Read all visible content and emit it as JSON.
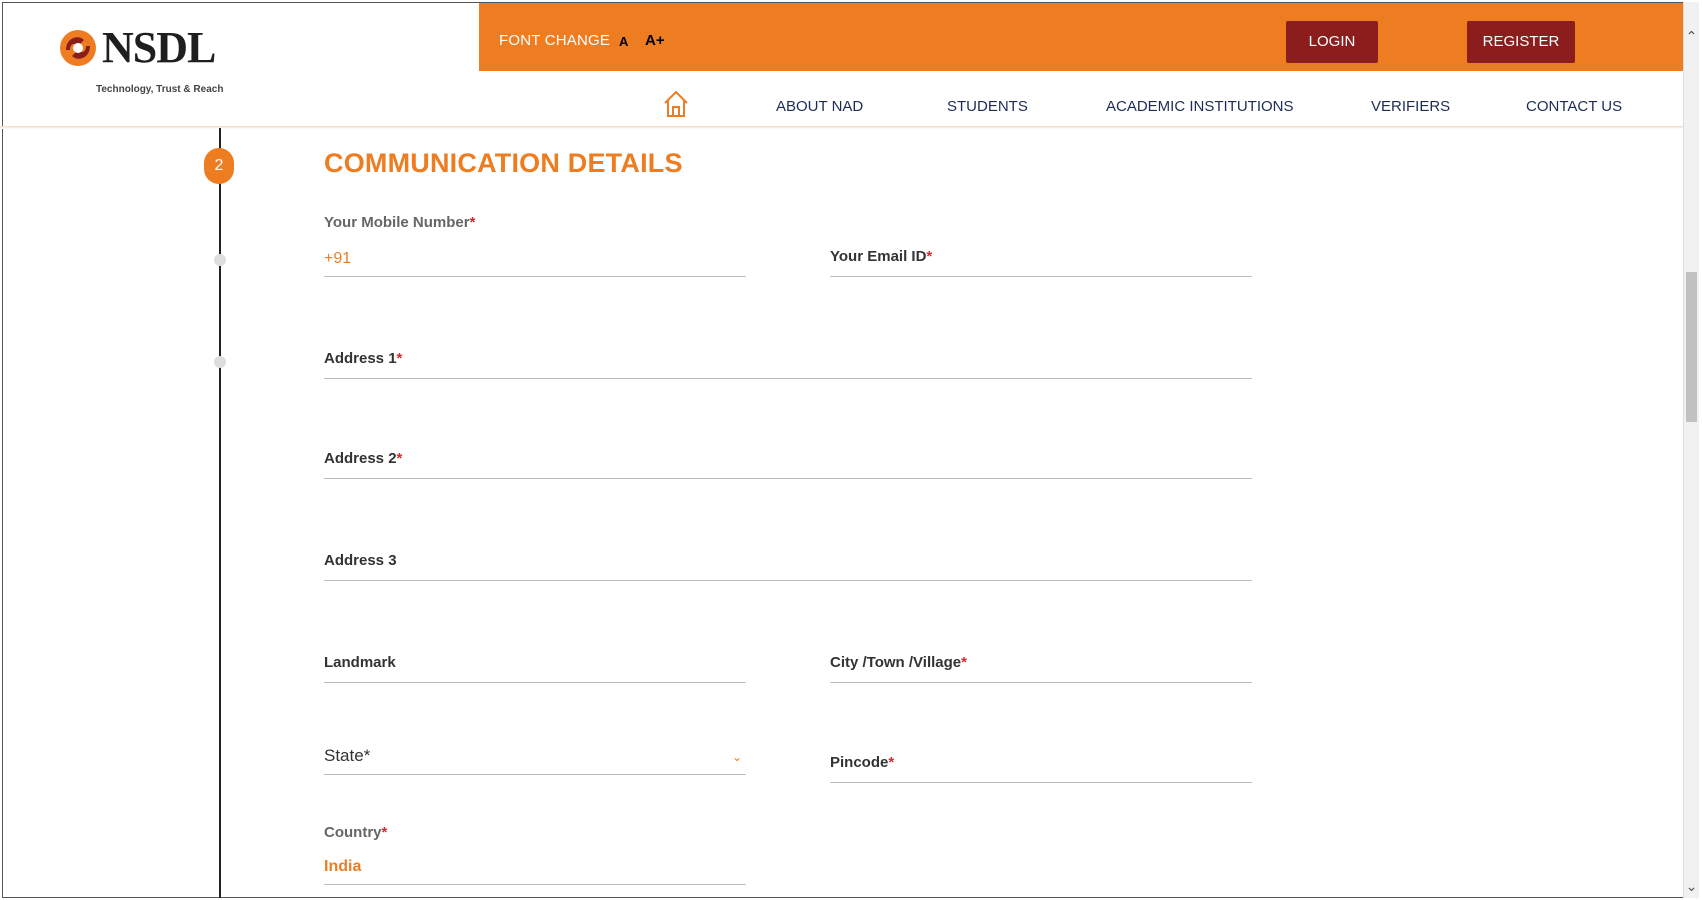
{
  "header": {
    "logo_text": "NSDL",
    "logo_tagline": "Technology, Trust & Reach",
    "font_change_label": "FONT CHANGE",
    "font_small_label": "A",
    "font_large_label": "A+",
    "login_label": "LOGIN",
    "register_label": "REGISTER",
    "accent_color": "#ee7d22",
    "button_color": "#8c1d1d"
  },
  "nav": {
    "items": [
      {
        "label": "ABOUT NAD"
      },
      {
        "label": "STUDENTS"
      },
      {
        "label": "ACADEMIC INSTITUTIONS"
      },
      {
        "label": "VERIFIERS"
      },
      {
        "label": "CONTACT US"
      }
    ],
    "home_icon": "home-icon"
  },
  "step": {
    "number": "2",
    "title": "COMMUNICATION DETAILS"
  },
  "form": {
    "mobile": {
      "label": "Your Mobile Number",
      "required": "*",
      "value": "+91"
    },
    "email": {
      "label": "Your Email ID",
      "required": "*",
      "value": ""
    },
    "address1": {
      "label": "Address 1",
      "required": "*",
      "value": ""
    },
    "address2": {
      "label": "Address 2",
      "required": "*",
      "value": ""
    },
    "address3": {
      "label": "Address 3",
      "value": ""
    },
    "landmark": {
      "label": "Landmark",
      "value": ""
    },
    "city": {
      "label": "City /Town /Village",
      "required": "*",
      "value": ""
    },
    "state": {
      "placeholder": "State*",
      "selected": ""
    },
    "pincode": {
      "label": "Pincode",
      "required": "*",
      "value": ""
    },
    "country": {
      "label": "Country",
      "required": "*",
      "value": "India"
    }
  }
}
